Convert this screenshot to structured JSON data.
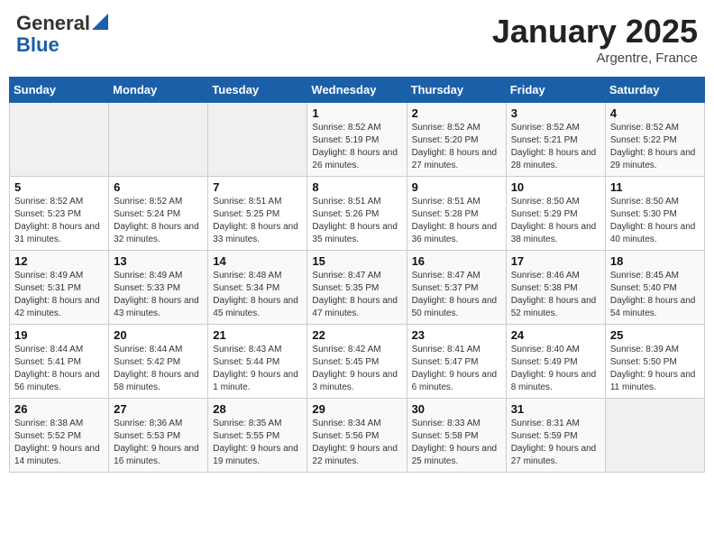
{
  "header": {
    "logo_general": "General",
    "logo_blue": "Blue",
    "month_title": "January 2025",
    "location": "Argentre, France"
  },
  "days_of_week": [
    "Sunday",
    "Monday",
    "Tuesday",
    "Wednesday",
    "Thursday",
    "Friday",
    "Saturday"
  ],
  "weeks": [
    [
      {
        "day": "",
        "empty": true
      },
      {
        "day": "",
        "empty": true
      },
      {
        "day": "",
        "empty": true
      },
      {
        "day": "1",
        "sunrise": "8:52 AM",
        "sunset": "5:19 PM",
        "daylight": "8 hours and 26 minutes."
      },
      {
        "day": "2",
        "sunrise": "8:52 AM",
        "sunset": "5:20 PM",
        "daylight": "8 hours and 27 minutes."
      },
      {
        "day": "3",
        "sunrise": "8:52 AM",
        "sunset": "5:21 PM",
        "daylight": "8 hours and 28 minutes."
      },
      {
        "day": "4",
        "sunrise": "8:52 AM",
        "sunset": "5:22 PM",
        "daylight": "8 hours and 29 minutes."
      }
    ],
    [
      {
        "day": "5",
        "sunrise": "8:52 AM",
        "sunset": "5:23 PM",
        "daylight": "8 hours and 31 minutes."
      },
      {
        "day": "6",
        "sunrise": "8:52 AM",
        "sunset": "5:24 PM",
        "daylight": "8 hours and 32 minutes."
      },
      {
        "day": "7",
        "sunrise": "8:51 AM",
        "sunset": "5:25 PM",
        "daylight": "8 hours and 33 minutes."
      },
      {
        "day": "8",
        "sunrise": "8:51 AM",
        "sunset": "5:26 PM",
        "daylight": "8 hours and 35 minutes."
      },
      {
        "day": "9",
        "sunrise": "8:51 AM",
        "sunset": "5:28 PM",
        "daylight": "8 hours and 36 minutes."
      },
      {
        "day": "10",
        "sunrise": "8:50 AM",
        "sunset": "5:29 PM",
        "daylight": "8 hours and 38 minutes."
      },
      {
        "day": "11",
        "sunrise": "8:50 AM",
        "sunset": "5:30 PM",
        "daylight": "8 hours and 40 minutes."
      }
    ],
    [
      {
        "day": "12",
        "sunrise": "8:49 AM",
        "sunset": "5:31 PM",
        "daylight": "8 hours and 42 minutes."
      },
      {
        "day": "13",
        "sunrise": "8:49 AM",
        "sunset": "5:33 PM",
        "daylight": "8 hours and 43 minutes."
      },
      {
        "day": "14",
        "sunrise": "8:48 AM",
        "sunset": "5:34 PM",
        "daylight": "8 hours and 45 minutes."
      },
      {
        "day": "15",
        "sunrise": "8:47 AM",
        "sunset": "5:35 PM",
        "daylight": "8 hours and 47 minutes."
      },
      {
        "day": "16",
        "sunrise": "8:47 AM",
        "sunset": "5:37 PM",
        "daylight": "8 hours and 50 minutes."
      },
      {
        "day": "17",
        "sunrise": "8:46 AM",
        "sunset": "5:38 PM",
        "daylight": "8 hours and 52 minutes."
      },
      {
        "day": "18",
        "sunrise": "8:45 AM",
        "sunset": "5:40 PM",
        "daylight": "8 hours and 54 minutes."
      }
    ],
    [
      {
        "day": "19",
        "sunrise": "8:44 AM",
        "sunset": "5:41 PM",
        "daylight": "8 hours and 56 minutes."
      },
      {
        "day": "20",
        "sunrise": "8:44 AM",
        "sunset": "5:42 PM",
        "daylight": "8 hours and 58 minutes."
      },
      {
        "day": "21",
        "sunrise": "8:43 AM",
        "sunset": "5:44 PM",
        "daylight": "9 hours and 1 minute."
      },
      {
        "day": "22",
        "sunrise": "8:42 AM",
        "sunset": "5:45 PM",
        "daylight": "9 hours and 3 minutes."
      },
      {
        "day": "23",
        "sunrise": "8:41 AM",
        "sunset": "5:47 PM",
        "daylight": "9 hours and 6 minutes."
      },
      {
        "day": "24",
        "sunrise": "8:40 AM",
        "sunset": "5:49 PM",
        "daylight": "9 hours and 8 minutes."
      },
      {
        "day": "25",
        "sunrise": "8:39 AM",
        "sunset": "5:50 PM",
        "daylight": "9 hours and 11 minutes."
      }
    ],
    [
      {
        "day": "26",
        "sunrise": "8:38 AM",
        "sunset": "5:52 PM",
        "daylight": "9 hours and 14 minutes."
      },
      {
        "day": "27",
        "sunrise": "8:36 AM",
        "sunset": "5:53 PM",
        "daylight": "9 hours and 16 minutes."
      },
      {
        "day": "28",
        "sunrise": "8:35 AM",
        "sunset": "5:55 PM",
        "daylight": "9 hours and 19 minutes."
      },
      {
        "day": "29",
        "sunrise": "8:34 AM",
        "sunset": "5:56 PM",
        "daylight": "9 hours and 22 minutes."
      },
      {
        "day": "30",
        "sunrise": "8:33 AM",
        "sunset": "5:58 PM",
        "daylight": "9 hours and 25 minutes."
      },
      {
        "day": "31",
        "sunrise": "8:31 AM",
        "sunset": "5:59 PM",
        "daylight": "9 hours and 27 minutes."
      },
      {
        "day": "",
        "empty": true
      }
    ]
  ],
  "labels": {
    "sunrise_label": "Sunrise:",
    "sunset_label": "Sunset:",
    "daylight_label": "Daylight:"
  }
}
